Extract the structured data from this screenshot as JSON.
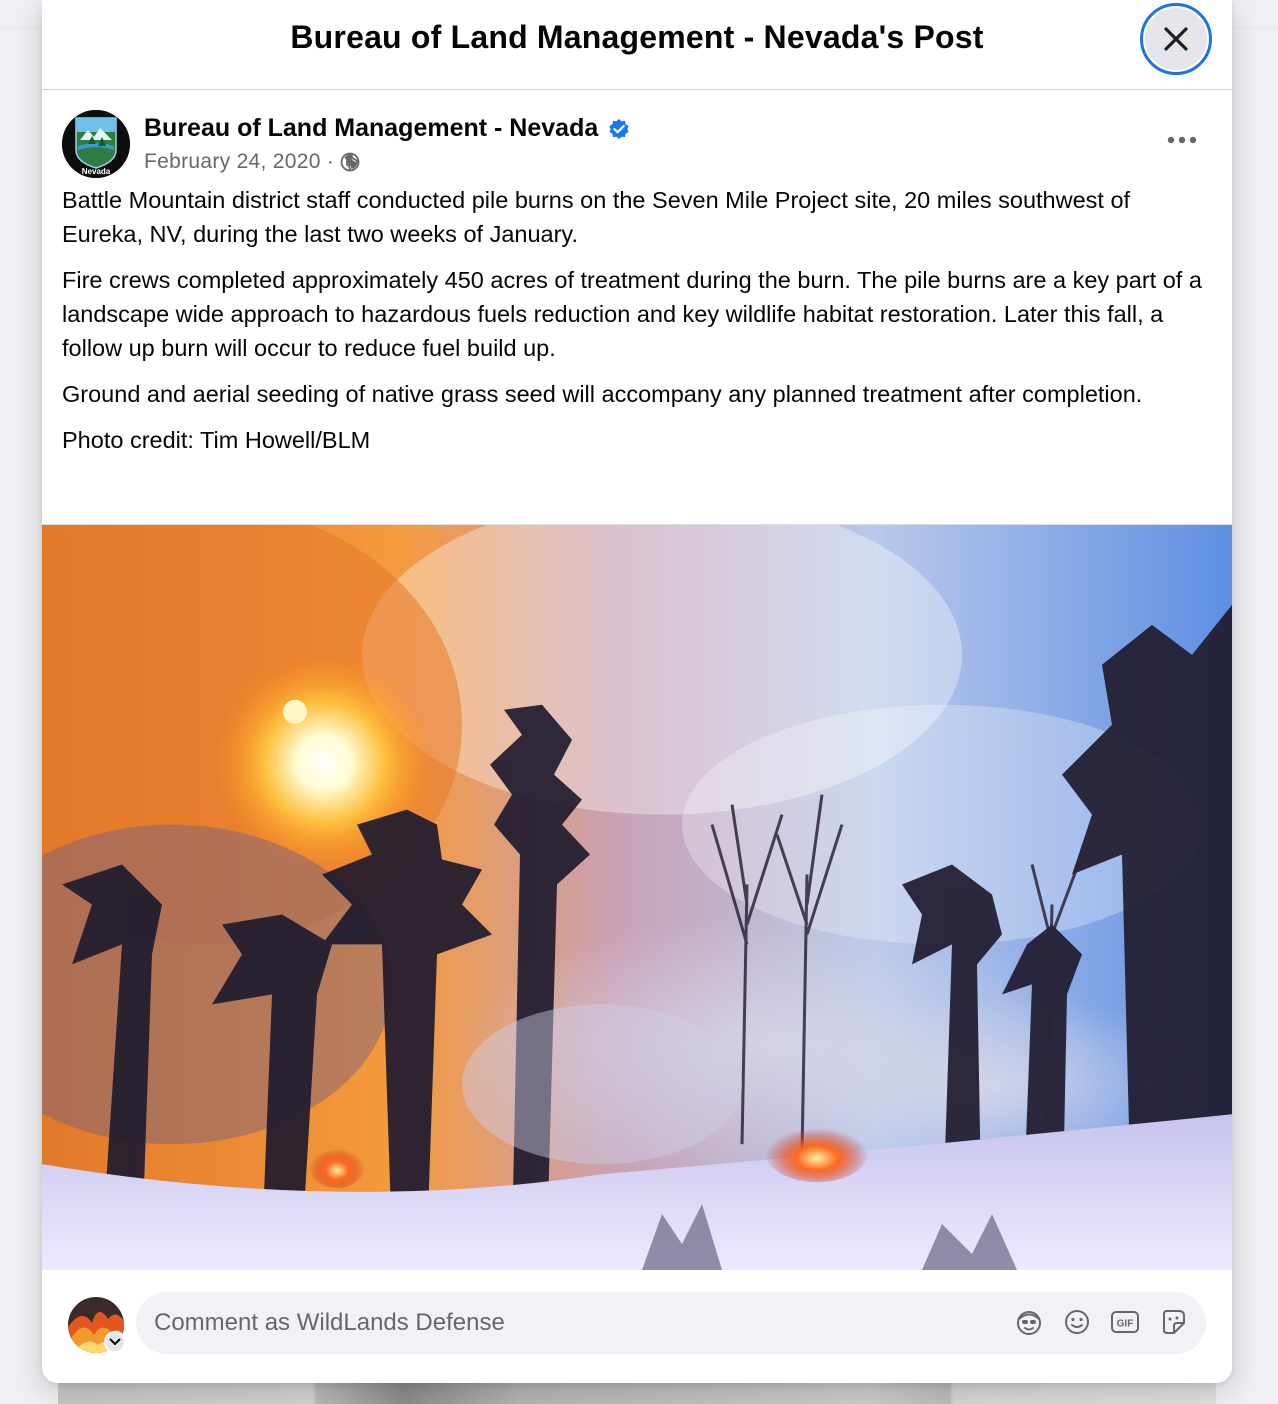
{
  "modal": {
    "title": "Bureau of Land Management - Nevada's Post"
  },
  "post": {
    "author": "Bureau of Land Management - Nevada",
    "avatar_caption": "Nevada",
    "date": "February 24, 2020",
    "separator": "·",
    "audience_icon": "globe-icon",
    "paragraphs": [
      "Battle Mountain district staff conducted pile burns on the Seven Mile Project site, 20 miles southwest of Eureka, NV, during the last two weeks of January.",
      "Fire crews completed approximately 450 acres of treatment during the burn. The pile burns are a key part of a landscape wide approach to hazardous fuels reduction and key wildlife habitat restoration.  Later this fall, a follow up burn will occur to reduce fuel build up.",
      "Ground and aerial seeding of native grass seed will accompany any planned treatment after completion.",
      "Photo credit: Tim Howell/BLM"
    ]
  },
  "comment": {
    "placeholder": "Comment as WildLands Defense",
    "tools": [
      "avatar-sticker-icon",
      "emoji-icon",
      "gif-icon",
      "sticker-icon"
    ],
    "gif_label": "GIF"
  },
  "colors": {
    "accent": "#1b74e4",
    "verified": "#1877f2",
    "secondary_text": "#65676b",
    "input_bg": "#f0f2f5"
  }
}
